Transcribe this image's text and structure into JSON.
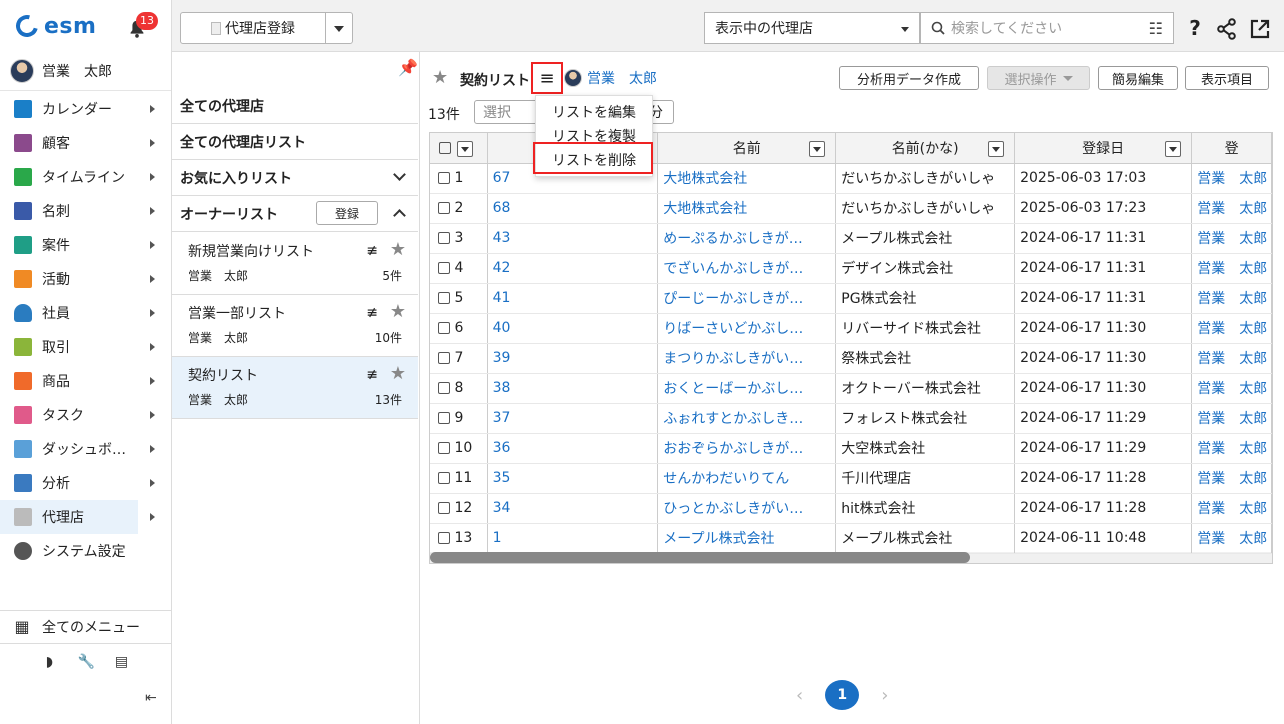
{
  "app": {
    "logo_text": "esm",
    "notification_count": "13",
    "user_name": "営業　太郎"
  },
  "nav": {
    "items": [
      {
        "label": "カレンダー",
        "icon": "calendar-icon",
        "color": "#1a7fc8"
      },
      {
        "label": "顧客",
        "icon": "building-icon",
        "color": "#8b4a8c"
      },
      {
        "label": "タイムライン",
        "icon": "chat-icon",
        "color": "#2aa84a"
      },
      {
        "label": "名刺",
        "icon": "business-card-icon",
        "color": "#3a5aa8"
      },
      {
        "label": "案件",
        "icon": "folder-icon",
        "color": "#1f9e86"
      },
      {
        "label": "活動",
        "icon": "clipboard-icon",
        "color": "#f08a24"
      },
      {
        "label": "社員",
        "icon": "person-icon",
        "color": "#2a7cc0"
      },
      {
        "label": "取引",
        "icon": "document-icon",
        "color": "#8bb53a"
      },
      {
        "label": "商品",
        "icon": "box-icon",
        "color": "#f06a2a"
      },
      {
        "label": "タスク",
        "icon": "task-check-icon",
        "color": "#e05a8a"
      },
      {
        "label": "ダッシュボ…",
        "icon": "dashboard-icon",
        "color": "#5aa0d8"
      },
      {
        "label": "分析",
        "icon": "chart-icon",
        "color": "#3a7ac0"
      },
      {
        "label": "代理店",
        "icon": "agency-icon",
        "color": "#bbbbbb"
      },
      {
        "label": "システム設定",
        "icon": "gear-icon",
        "color": "#555555"
      }
    ],
    "all_menu_label": "全てのメニュー"
  },
  "topbar": {
    "register_label": "代理店登録",
    "scope_value": "表示中の代理店",
    "search_placeholder": "検索してください"
  },
  "list_panel": {
    "all_agencies": "全ての代理店",
    "all_agency_lists": "全ての代理店リスト",
    "favorites": "お気に入りリスト",
    "owner_lists": "オーナーリスト",
    "register_label": "登録",
    "cards": [
      {
        "title": "新規営業向けリスト",
        "owner": "営業　太郎",
        "count": "5件"
      },
      {
        "title": "営業一部リスト",
        "owner": "営業　太郎",
        "count": "10件"
      },
      {
        "title": "契約リスト",
        "owner": "営業　太郎",
        "count": "13件"
      }
    ]
  },
  "main": {
    "list_title": "契約リスト",
    "owner_name": "営業　太郎",
    "buttons": {
      "analysis": "分析用データ作成",
      "bulk": "選択操作",
      "quick_edit": "簡易編集",
      "columns": "表示項目"
    },
    "count": "13件",
    "select_placeholder": "選択",
    "select_suffix": "分",
    "menu": {
      "edit": "リストを編集",
      "copy": "リストを複製",
      "delete": "リストを削除"
    },
    "columns": [
      "",
      "名前",
      "名前(かな)",
      "登録日",
      "登"
    ],
    "rows": [
      {
        "n": "1",
        "id": "67",
        "name": "大地株式会社",
        "kana": "だいちかぶしきがいしゃ",
        "date": "2025-06-03 17:03",
        "owner": "営業　太郎"
      },
      {
        "n": "2",
        "id": "68",
        "name": "大地株式会社",
        "kana": "だいちかぶしきがいしゃ",
        "date": "2025-06-03 17:23",
        "owner": "営業　太郎"
      },
      {
        "n": "3",
        "id": "43",
        "name": "めーぷるかぶしきが…",
        "kana": "メープル株式会社",
        "date": "2024-06-17 11:31",
        "owner": "営業　太郎"
      },
      {
        "n": "4",
        "id": "42",
        "name": "でざいんかぶしきが…",
        "kana": "デザイン株式会社",
        "date": "2024-06-17 11:31",
        "owner": "営業　太郎"
      },
      {
        "n": "5",
        "id": "41",
        "name": "ぴーじーかぶしきが…",
        "kana": "PG株式会社",
        "date": "2024-06-17 11:31",
        "owner": "営業　太郎"
      },
      {
        "n": "6",
        "id": "40",
        "name": "りばーさいどかぶし…",
        "kana": "リバーサイド株式会社",
        "date": "2024-06-17 11:30",
        "owner": "営業　太郎"
      },
      {
        "n": "7",
        "id": "39",
        "name": "まつりかぶしきがい…",
        "kana": "祭株式会社",
        "date": "2024-06-17 11:30",
        "owner": "営業　太郎"
      },
      {
        "n": "8",
        "id": "38",
        "name": "おくとーばーかぶし…",
        "kana": "オクトーバー株式会社",
        "date": "2024-06-17 11:30",
        "owner": "営業　太郎"
      },
      {
        "n": "9",
        "id": "37",
        "name": "ふぉれすとかぶしき…",
        "kana": "フォレスト株式会社",
        "date": "2024-06-17 11:29",
        "owner": "営業　太郎"
      },
      {
        "n": "10",
        "id": "36",
        "name": "おおぞらかぶしきが…",
        "kana": "大空株式会社",
        "date": "2024-06-17 11:29",
        "owner": "営業　太郎"
      },
      {
        "n": "11",
        "id": "35",
        "name": "せんかわだいりてん",
        "kana": "千川代理店",
        "date": "2024-06-17 11:28",
        "owner": "営業　太郎"
      },
      {
        "n": "12",
        "id": "34",
        "name": "ひっとかぶしきがい…",
        "kana": "hit株式会社",
        "date": "2024-06-17 11:28",
        "owner": "営業　太郎"
      },
      {
        "n": "13",
        "id": "1",
        "name": "メープル株式会社",
        "kana": "メープル株式会社",
        "date": "2024-06-11 10:48",
        "owner": "営業　太郎"
      }
    ]
  },
  "pager": {
    "current": "1"
  }
}
